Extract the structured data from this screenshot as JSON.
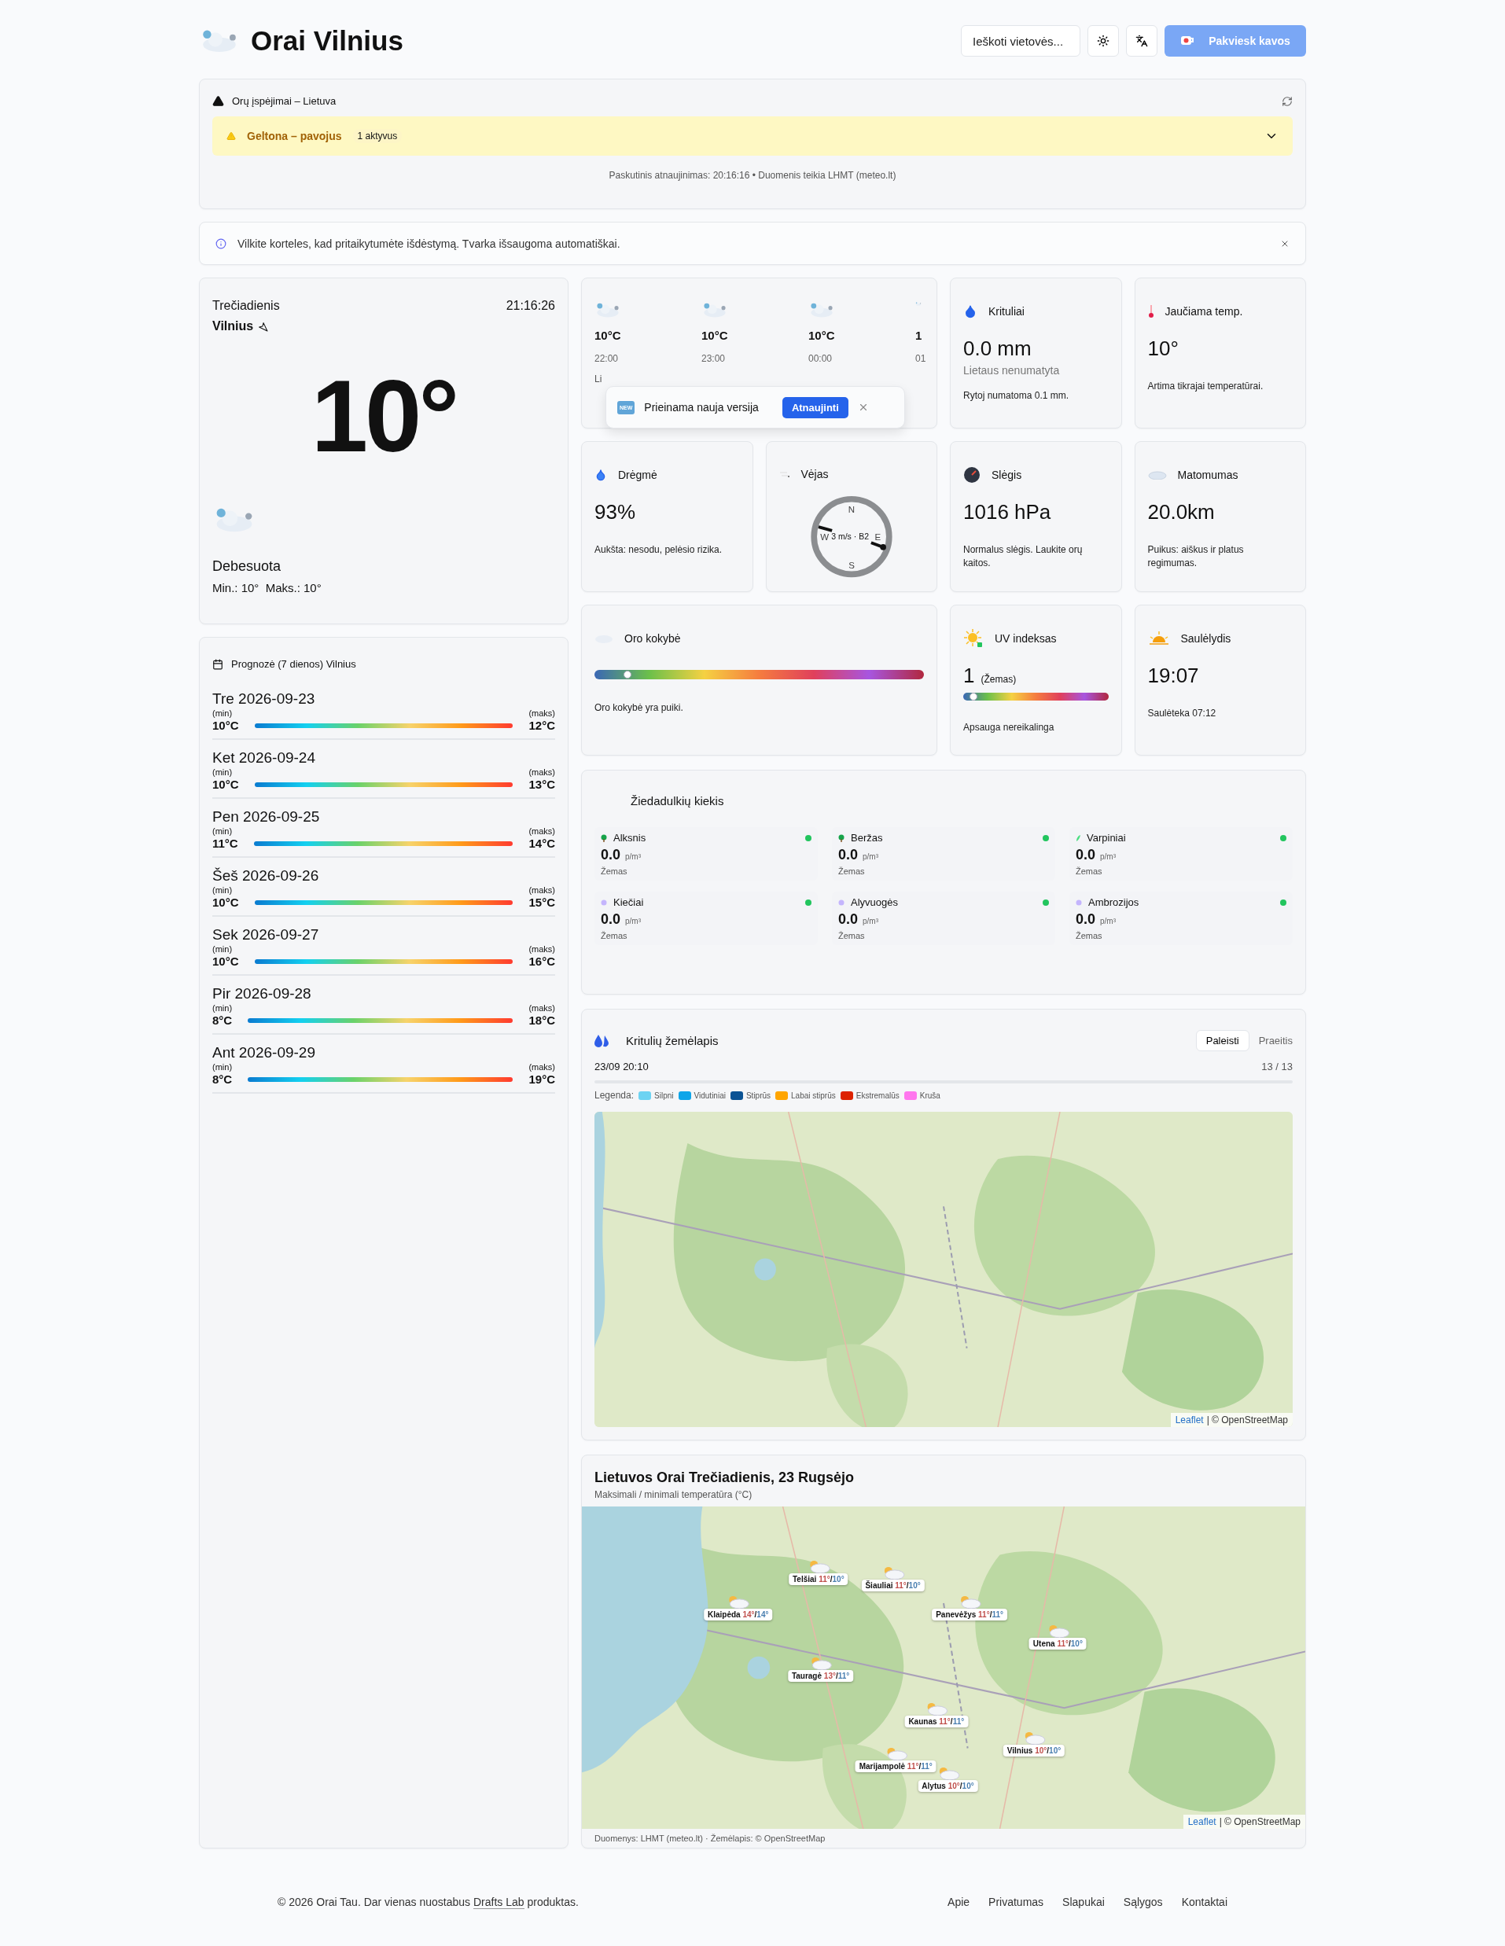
{
  "header": {
    "title": "Orai Vilnius",
    "search": {
      "placeholder": "Ieškoti vietovės..."
    },
    "donate_button": "Pakviesk kavos"
  },
  "alerts": {
    "title": "Orų įspėjimai – Lietuva",
    "warning": {
      "label": "Geltona – pavojus",
      "count": "1 aktyvus",
      "expanded": false
    },
    "updated": "Paskutinis atnaujinimas: 20:16:16 • Duomenis teikia LHMT (meteo.lt)"
  },
  "info_bar": {
    "text": "Vilkite korteles, kad pritaikytumėte išdėstymą. Tvarka išsaugoma automatiškai."
  },
  "current": {
    "day": "Trečiadienis",
    "time": "21:16:26",
    "city": "Vilnius",
    "temperature": "10°",
    "condition": "Debesuota",
    "min_max": "Min.: 10°  Maks.: 10°"
  },
  "forecast": {
    "title": "Prognozė (7 dienos) Vilnius",
    "days": [
      {
        "date": "Tre 2026-09-23",
        "min_label": "(min)",
        "min": "10°C",
        "max_label": "(maks)",
        "max": "12°C"
      },
      {
        "date": "Ket 2026-09-24",
        "min_label": "(min)",
        "min": "10°C",
        "max_label": "(maks)",
        "max": "13°C"
      },
      {
        "date": "Pen 2026-09-25",
        "min_label": "(min)",
        "min": "11°C",
        "max_label": "(maks)",
        "max": "14°C"
      },
      {
        "date": "Šeš 2026-09-26",
        "min_label": "(min)",
        "min": "10°C",
        "max_label": "(maks)",
        "max": "15°C"
      },
      {
        "date": "Sek 2026-09-27",
        "min_label": "(min)",
        "min": "10°C",
        "max_label": "(maks)",
        "max": "16°C"
      },
      {
        "date": "Pir 2026-09-28",
        "min_label": "(min)",
        "min": "8°C",
        "max_label": "(maks)",
        "max": "18°C"
      },
      {
        "date": "Ant 2026-09-29",
        "min_label": "(min)",
        "min": "8°C",
        "max_label": "(maks)",
        "max": "19°C"
      }
    ]
  },
  "tiles": [
    {
      "kind": "hourly",
      "hours": [
        {
          "temperature": "10°C",
          "time": "22:00"
        },
        {
          "temperature": "10°C",
          "time": "23:00"
        },
        {
          "temperature": "10°C",
          "time": "00:00"
        },
        {
          "temperature": "1",
          "time": "01"
        }
      ],
      "note": "Li",
      "toast": {
        "badge": "NEW",
        "text": "Prieinama nauja versija",
        "button": "Atnaujinti"
      }
    },
    {
      "kind": "precipitation",
      "title": "Krituliai",
      "value": "0.0 mm",
      "subtitle": "Lietaus nenumatyta",
      "note": "Rytoj numatoma 0.1 mm."
    },
    {
      "kind": "feels_like",
      "title": "Jaučiama temp.",
      "value": "10°",
      "note": "Artima tikrajai temperatūrai."
    },
    {
      "kind": "humidity",
      "title": "Drėgmė",
      "value": "93%",
      "note": "Aukšta: nesodu, pelėsio rizika."
    },
    {
      "kind": "wind",
      "title": "Vėjas",
      "reading": "3 m/s · B2",
      "directions": [
        "N",
        "E",
        "S",
        "W"
      ]
    },
    {
      "kind": "pressure",
      "title": "Slėgis",
      "value": "1016 hPa",
      "note": "Normalus slėgis. Laukite orų kaitos."
    },
    {
      "kind": "visibility",
      "title": "Matomumas",
      "value": "20.0km",
      "note": "Puikus: aiškus ir platus regimumas."
    },
    {
      "kind": "air_quality",
      "title": "Oro kokybė",
      "level": 0.1,
      "note": "Oro kokybė yra puiki."
    },
    {
      "kind": "uv",
      "title": "UV indeksas",
      "value": "1",
      "rating": "(Žemas)",
      "level": 0.07,
      "note": "Apsauga nereikalinga"
    },
    {
      "kind": "sunset",
      "title": "Saulėlydis",
      "value": "19:07",
      "note": "Saulėteka 07:12"
    }
  ],
  "pollen": {
    "title": "Žiedadulkių kiekis",
    "items": [
      {
        "name": "Alksnis",
        "kind": "tree",
        "value": "0.0",
        "unit": "p/m³",
        "rating": "Žemas",
        "color": "#22c55e"
      },
      {
        "name": "Beržas",
        "kind": "tree",
        "value": "0.0",
        "unit": "p/m³",
        "rating": "Žemas",
        "color": "#22c55e"
      },
      {
        "name": "Varpiniai",
        "kind": "grass",
        "value": "0.0",
        "unit": "p/m³",
        "rating": "Žemas",
        "color": "#22c55e"
      },
      {
        "name": "Kiečiai",
        "kind": "weed",
        "value": "0.0",
        "unit": "p/m³",
        "rating": "Žemas",
        "color": "#22c55e"
      },
      {
        "name": "Alyvuogės",
        "kind": "weed",
        "value": "0.0",
        "unit": "p/m³",
        "rating": "Žemas",
        "color": "#22c55e"
      },
      {
        "name": "Ambrozijos",
        "kind": "weed",
        "value": "0.0",
        "unit": "p/m³",
        "rating": "Žemas",
        "color": "#22c55e"
      }
    ]
  },
  "radar": {
    "title": "Kritulių žemėlapis",
    "play_button": "Paleisti",
    "past_button": "Praeitis",
    "timestamp": "23/09 20:10",
    "frame": "13 / 13",
    "legend_label": "Legenda:",
    "legend": [
      {
        "label": "Silpni",
        "color": "#6dd3f2"
      },
      {
        "label": "Vidutiniai",
        "color": "#0ea5e9"
      },
      {
        "label": "Stiprūs",
        "color": "#0b5394"
      },
      {
        "label": "Labai stiprūs",
        "color": "#ffa500"
      },
      {
        "label": "Ekstremalūs",
        "color": "#dd2200"
      },
      {
        "label": "Kruša",
        "color": "#ff77ee"
      }
    ],
    "attribution_link": "Leaflet",
    "attribution": "| © OpenStreetMap"
  },
  "country_map": {
    "title": "Lietuvos Orai Trečiadienis, 23 Rugsėjo",
    "subtitle": "Maksimali / minimali temperatūra (°C)",
    "cities": [
      {
        "name": "Telšiai",
        "max": "11°",
        "separator": "/",
        "min": "10°"
      },
      {
        "name": "Šiauliai",
        "max": "11°",
        "separator": "/",
        "min": "10°"
      },
      {
        "name": "Klaipėda",
        "max": "14°",
        "separator": "/",
        "min": "14°"
      },
      {
        "name": "Panevėžys",
        "max": "11°",
        "separator": "/",
        "min": "11°"
      },
      {
        "name": "Utena",
        "max": "11°",
        "separator": "/",
        "min": "10°"
      },
      {
        "name": "Tauragė",
        "max": "13°",
        "separator": "/",
        "min": "11°"
      },
      {
        "name": "Kaunas",
        "max": "11°",
        "separator": "/",
        "min": "11°"
      },
      {
        "name": "Vilnius",
        "max": "10°",
        "separator": "/",
        "min": "10°"
      },
      {
        "name": "Marijampolė",
        "max": "11°",
        "separator": "/",
        "min": "11°"
      },
      {
        "name": "Alytus",
        "max": "10°",
        "separator": "/",
        "min": "10°"
      }
    ],
    "attribution_link": "Leaflet",
    "attribution": "| © OpenStreetMap",
    "source": "Duomenys: LHMT (meteo.lt) · Žemėlapis: © OpenStreetMap"
  },
  "footer": {
    "copyright_start": "© 2026 Orai Tau. Dar vienas nuostabus",
    "copyright_link": "Drafts Lab",
    "copyright_end": "produktas.",
    "links": [
      "Apie",
      "Privatumas",
      "Slapukai",
      "Sąlygos",
      "Kontaktai"
    ]
  }
}
